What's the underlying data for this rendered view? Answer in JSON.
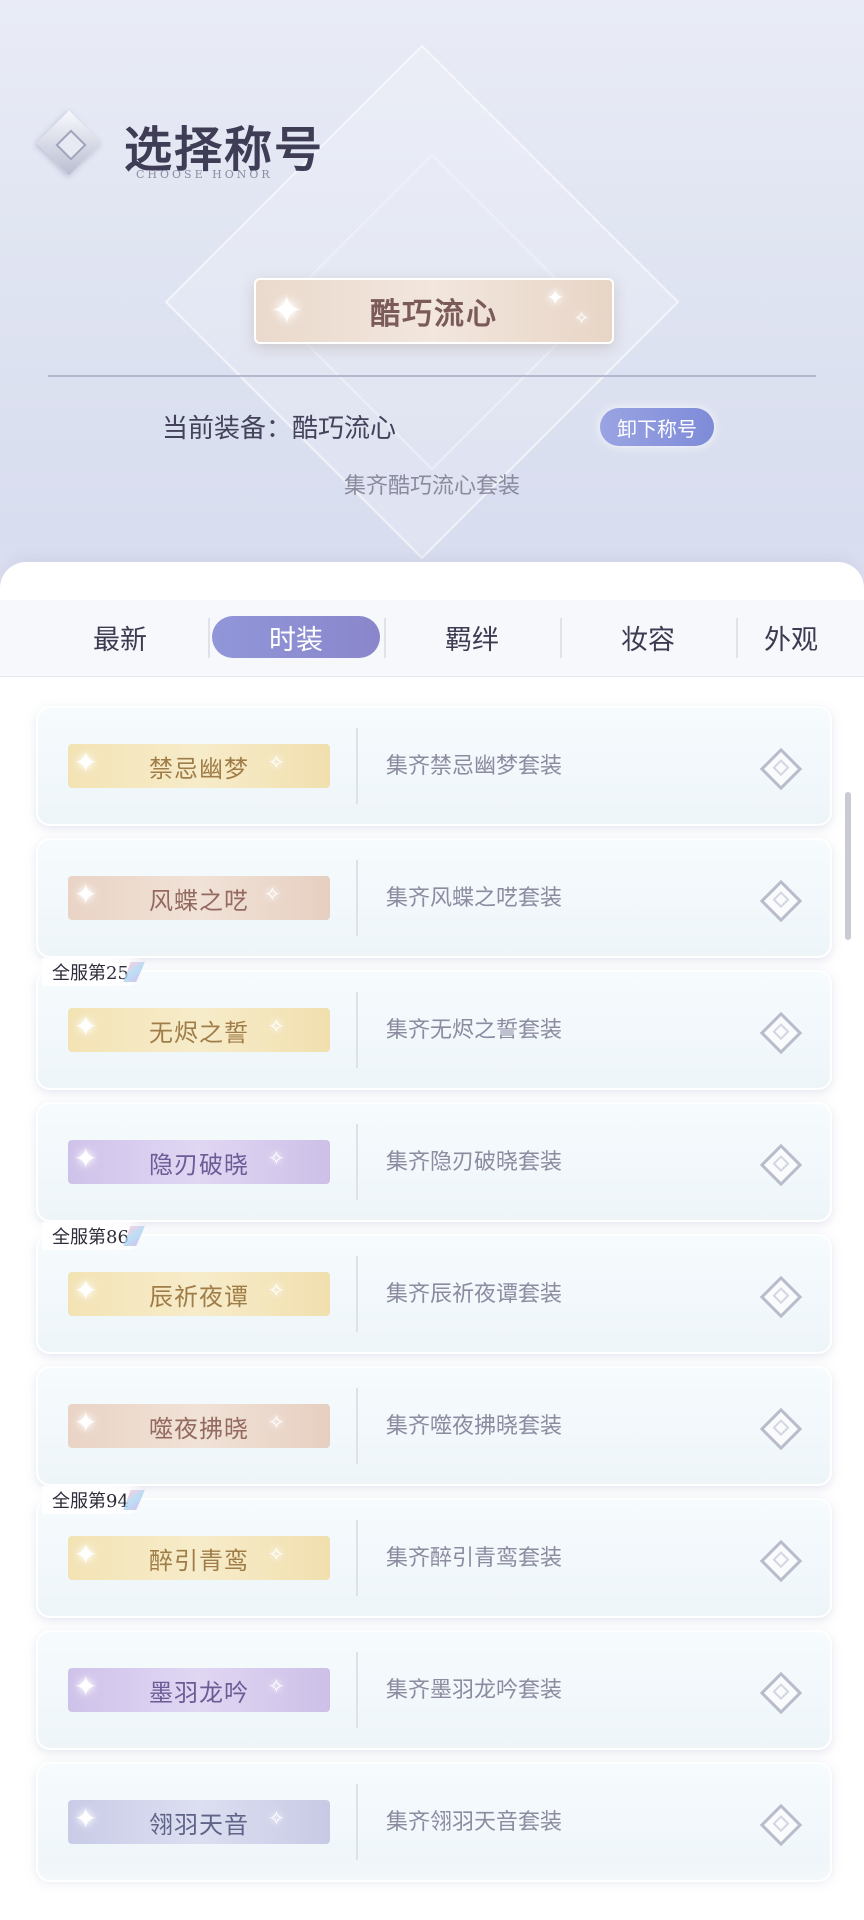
{
  "header": {
    "title": "选择称号",
    "subtitle": "CHOOSE HONOR"
  },
  "current": {
    "banner_title": "酷巧流心",
    "equip_label": "当前装备：酷巧流心",
    "unequip_button": "卸下称号",
    "condition": "集齐酷巧流心套装"
  },
  "tabs": [
    {
      "label": "最新"
    },
    {
      "label": "时装",
      "active": true
    },
    {
      "label": "羁绊"
    },
    {
      "label": "妆容"
    },
    {
      "label": "外观"
    }
  ],
  "titles": [
    {
      "name": "禁忌幽梦",
      "desc": "集齐禁忌幽梦套装",
      "style": "gold",
      "rank": ""
    },
    {
      "name": "风蝶之呓",
      "desc": "集齐风蝶之呓套装",
      "style": "rose",
      "rank": ""
    },
    {
      "name": "无烬之誓",
      "desc": "集齐无烬之誓套装",
      "style": "gold",
      "rank": "全服第25"
    },
    {
      "name": "隐刃破晓",
      "desc": "集齐隐刃破晓套装",
      "style": "purple",
      "rank": ""
    },
    {
      "name": "辰祈夜谭",
      "desc": "集齐辰祈夜谭套装",
      "style": "gold",
      "rank": "全服第86"
    },
    {
      "name": "噬夜拂晓",
      "desc": "集齐噬夜拂晓套装",
      "style": "rose",
      "rank": ""
    },
    {
      "name": "醉引青鸾",
      "desc": "集齐醉引青鸾套装",
      "style": "gold",
      "rank": "全服第94"
    },
    {
      "name": "墨羽龙吟",
      "desc": "集齐墨羽龙吟套装",
      "style": "purple",
      "rank": ""
    },
    {
      "name": "翎羽天音",
      "desc": "集齐翎羽天音套装",
      "style": "blue",
      "rank": ""
    }
  ],
  "colors": {
    "accent": "#8a8fd6",
    "title_text": "#3e3d55"
  }
}
